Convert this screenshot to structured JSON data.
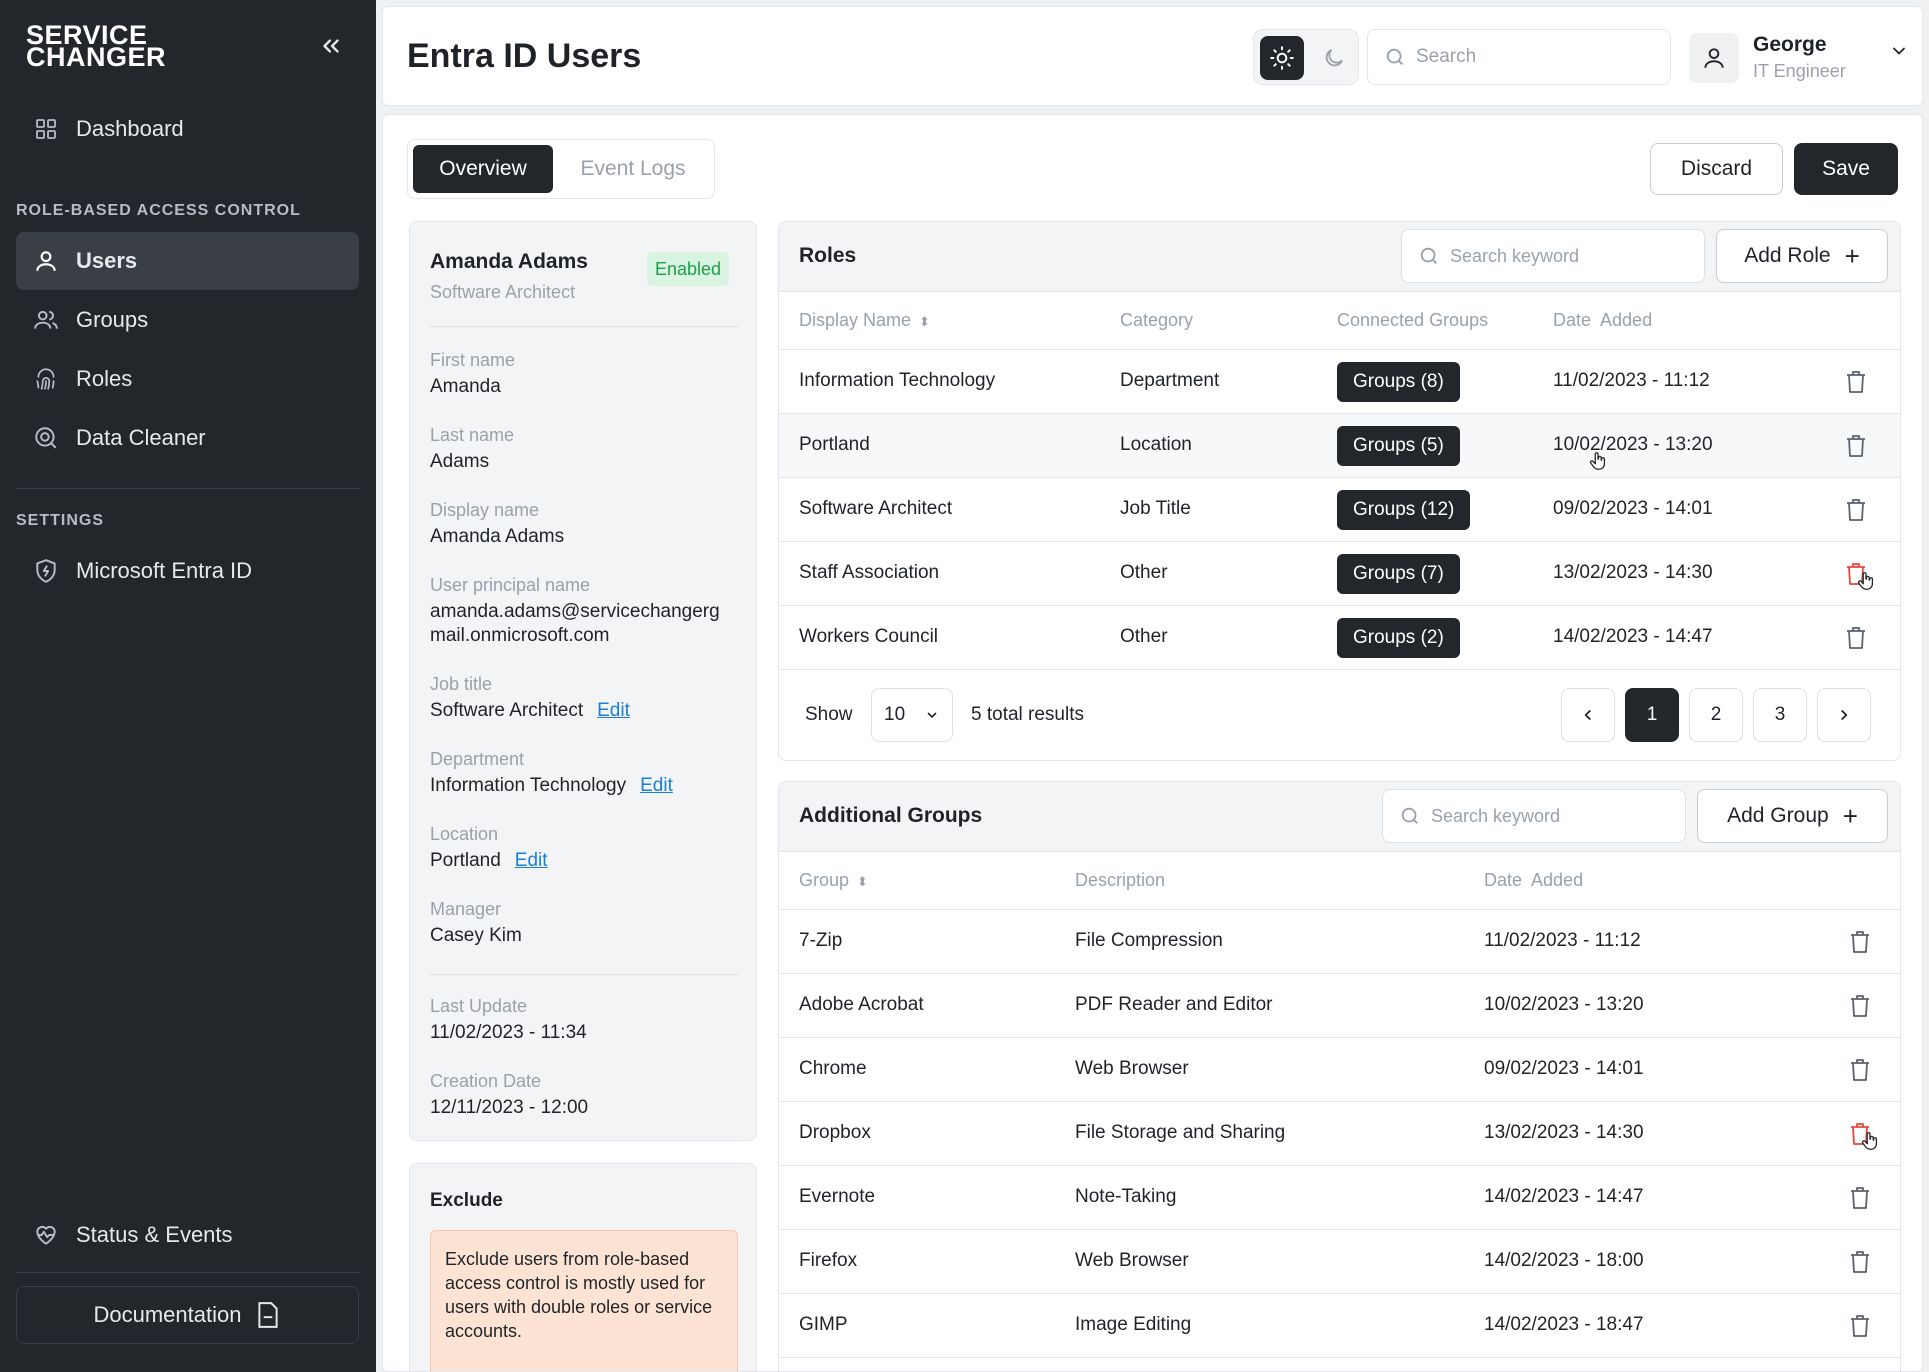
{
  "brand": {
    "line1": "SERVICE",
    "line2": "CHANGER"
  },
  "sidebar": {
    "dashboard": "Dashboard",
    "section_rbac": "ROLE-BASED ACCESS CONTROL",
    "items": [
      {
        "label": "Users",
        "icon": "user-icon"
      },
      {
        "label": "Groups",
        "icon": "users-icon"
      },
      {
        "label": "Roles",
        "icon": "fingerprint-icon"
      },
      {
        "label": "Data Cleaner",
        "icon": "scan-search-icon"
      }
    ],
    "section_settings": "SETTINGS",
    "settings_item": "Microsoft Entra ID",
    "status_events": "Status & Events",
    "documentation": "Documentation"
  },
  "header": {
    "title": "Entra ID Users",
    "search_placeholder": "Search",
    "user_name": "George",
    "user_role": "IT Engineer"
  },
  "tabs": {
    "overview": "Overview",
    "event_logs": "Event Logs"
  },
  "actions": {
    "discard": "Discard",
    "save": "Save"
  },
  "profile": {
    "name": "Amanda Adams",
    "title": "Software Architect",
    "status": "Enabled",
    "edit_label": "Edit",
    "first_name_label": "First name",
    "first_name": "Amanda",
    "last_name_label": "Last name",
    "last_name": "Adams",
    "display_name_label": "Display name",
    "display_name": "Amanda Adams",
    "upn_label": "User principal name",
    "upn_line1": "amanda.adams@servicechangerg",
    "upn_line2": "mail.onmicrosoft.com",
    "job_title_label": "Job title",
    "job_title": "Software Architect",
    "department_label": "Department",
    "department": "Information Technology",
    "location_label": "Location",
    "location": "Portland",
    "manager_label": "Manager",
    "manager": "Casey Kim",
    "last_update_label": "Last Update",
    "last_update": "11/02/2023 - 11:34",
    "creation_date_label": "Creation Date",
    "creation_date": "12/11/2023 - 12:00"
  },
  "exclude": {
    "title": "Exclude",
    "note": "Exclude users from role-based access control is mostly used for users with double roles or service accounts."
  },
  "roles": {
    "title": "Roles",
    "search_placeholder": "Search keyword",
    "add_label": "Add Role",
    "columns": [
      "Display Name",
      "Category",
      "Connected Groups",
      "Date  Added"
    ],
    "rows": [
      {
        "name": "Information Technology",
        "category": "Department",
        "groups": "Groups (8)",
        "date": "11/02/2023 - 11:12"
      },
      {
        "name": "Portland",
        "category": "Location",
        "groups": "Groups (5)",
        "date": "10/02/2023 - 13:20"
      },
      {
        "name": "Software Architect",
        "category": "Job Title",
        "groups": "Groups (12)",
        "date": "09/02/2023 - 14:01"
      },
      {
        "name": "Staff Association",
        "category": "Other",
        "groups": "Groups (7)",
        "date": "13/02/2023 - 14:30"
      },
      {
        "name": "Workers Council",
        "category": "Other",
        "groups": "Groups (2)",
        "date": "14/02/2023 - 14:47"
      }
    ],
    "show_label": "Show",
    "page_size": "10",
    "total": "5 total results",
    "pages": [
      "1",
      "2",
      "3"
    ]
  },
  "groups": {
    "title": "Additional Groups",
    "search_placeholder": "Search keyword",
    "add_label": "Add Group",
    "columns": [
      "Group",
      "Description",
      "Date  Added"
    ],
    "rows": [
      {
        "name": "7-Zip",
        "desc": "File Compression",
        "date": "11/02/2023 - 11:12"
      },
      {
        "name": "Adobe Acrobat",
        "desc": "PDF Reader and Editor",
        "date": "10/02/2023 - 13:20"
      },
      {
        "name": "Chrome",
        "desc": "Web Browser",
        "date": "09/02/2023 - 14:01"
      },
      {
        "name": "Dropbox",
        "desc": "File Storage and Sharing",
        "date": "13/02/2023 - 14:30"
      },
      {
        "name": "Evernote",
        "desc": "Note-Taking",
        "date": "14/02/2023 - 14:47"
      },
      {
        "name": "Firefox",
        "desc": "Web Browser",
        "date": "14/02/2023 - 18:00"
      },
      {
        "name": "GIMP",
        "desc": "Image Editing",
        "date": "14/02/2023 - 18:47"
      }
    ]
  },
  "colors": {
    "sidebar_bg": "#23262b",
    "accent_dark": "#23262b",
    "enabled_green": "#1f9d4a",
    "link_blue": "#1a7fd8",
    "danger_red": "#e5483b",
    "note_bg": "#fde3d3"
  }
}
